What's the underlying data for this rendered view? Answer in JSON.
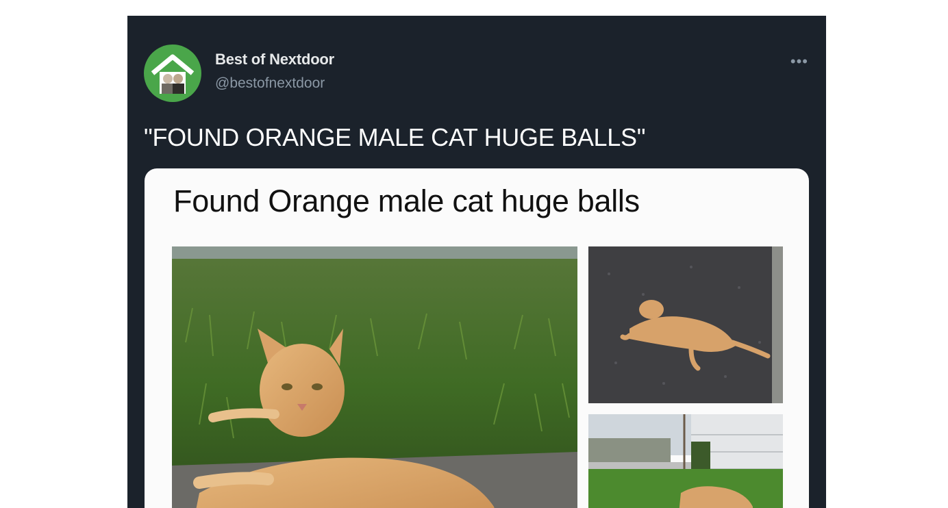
{
  "tweet": {
    "author_name": "Best of Nextdoor",
    "author_handle": "@bestofnextdoor",
    "more_icon": "more-dots-icon",
    "text": "\"FOUND ORANGE MALE CAT HUGE BALLS\""
  },
  "card": {
    "title": "Found Orange male cat huge balls"
  },
  "colors": {
    "tweet_background": "#1b222b",
    "avatar_green": "#4aa64a",
    "handle_gray": "#8b98a5",
    "card_background": "#fbfbfb"
  }
}
